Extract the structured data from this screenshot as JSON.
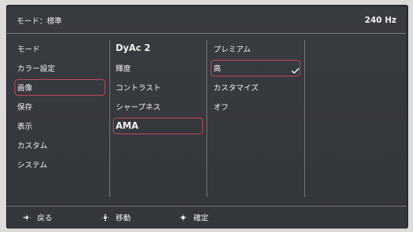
{
  "header": {
    "title": "モード：標準",
    "refresh_rate": "240 Hz"
  },
  "menu": {
    "col1": [
      "モード",
      "カラー設定",
      "画像",
      "保存",
      "表示",
      "カスタム",
      "システム"
    ],
    "col2": [
      "DyAc 2",
      "輝度",
      "コントラスト",
      "シャープネス",
      "AMA"
    ],
    "col3": [
      "プレミアム",
      "高",
      "カスタマイズ",
      "オフ"
    ],
    "selected": {
      "col1": "画像",
      "col2": "AMA",
      "col3": "高"
    },
    "checked_icon": "checkmark-icon"
  },
  "footer": {
    "back": "戻る",
    "move": "移動",
    "confirm": "確定",
    "icons": [
      "joystick-left-icon",
      "joystick-updown-icon",
      "joystick-press-icon"
    ]
  },
  "colors": {
    "background": "#383b40",
    "text": "#f2f2f2",
    "divider": "#7d8084",
    "selection": "#d8485e"
  }
}
